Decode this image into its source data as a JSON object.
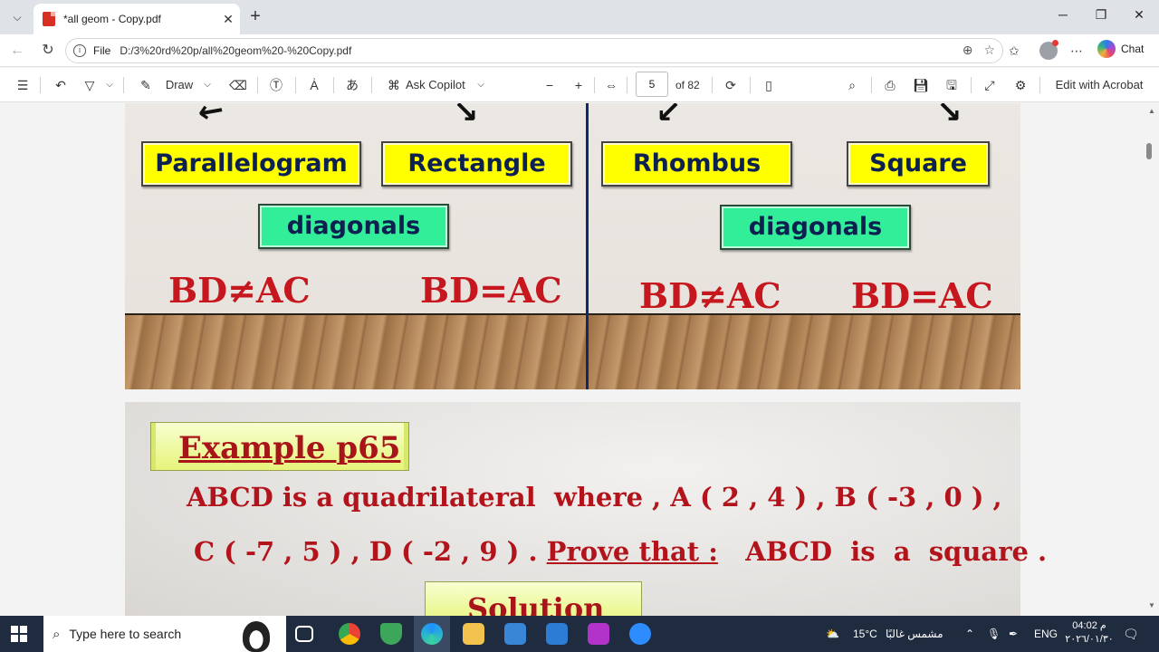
{
  "browser": {
    "tab_title": "*all geom - Copy.pdf",
    "address_label": "File",
    "address_url": "D:/3%20rd%20p/all%20geom%20-%20Copy.pdf",
    "chat_label": "Chat"
  },
  "toolbar": {
    "draw_label": "Draw",
    "copilot_label": "Ask Copilot",
    "page_number": "5",
    "page_total": "of 82",
    "edit_label": "Edit with Acrobat"
  },
  "slide1": {
    "shapes": [
      "Parallelogram",
      "Rectangle",
      "Rhombus",
      "Square"
    ],
    "diagonals_label_left": "diagonals",
    "diagonals_label_right": "diagonals",
    "equations": [
      "BD≠AC",
      "BD=AC",
      "BD≠AC",
      "BD=AC"
    ]
  },
  "slide2": {
    "example_title": "Example p65",
    "line1": "ABCD is a quadrilateral  where , A ( 2 , 4 ) , B ( -3 , 0 ) ,",
    "line2_a": "C ( -7 , 5 ) , D ( -2 , 9 ) . ",
    "line2_prove": "Prove that :",
    "line2_b": "   ABCD  is  a  square .",
    "solution_title": "Solution"
  },
  "taskbar": {
    "search_placeholder": "Type here to search",
    "weather_temp": "15°C",
    "weather_text": "مشمس غالبًا",
    "language": "ENG",
    "time": "04:02 م",
    "date": "٢٠٢٦/٠١/٣٠"
  },
  "colors": {
    "shape_box": "#ffff00",
    "diagonal_box": "#33ee99",
    "equation_red": "#c7171e",
    "divider_blue": "#0d2a6b",
    "taskbar": "#1f2b3e"
  }
}
